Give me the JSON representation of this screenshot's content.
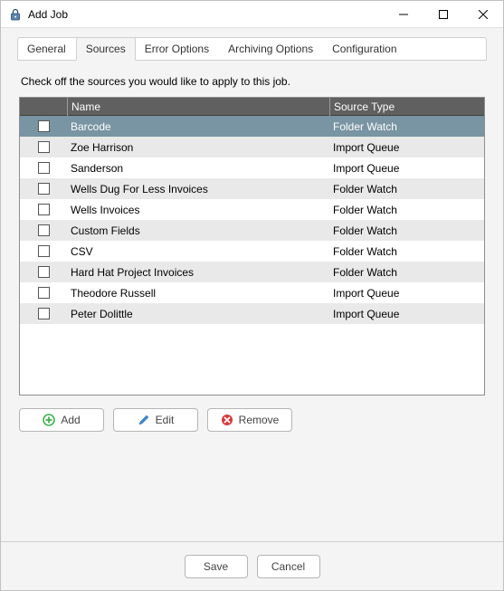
{
  "window": {
    "title": "Add Job"
  },
  "tabs": [
    {
      "label": "General"
    },
    {
      "label": "Sources"
    },
    {
      "label": "Error Options"
    },
    {
      "label": "Archiving Options"
    },
    {
      "label": "Configuration"
    }
  ],
  "instruction": "Check off the sources you would like to apply to this job.",
  "columns": {
    "name": "Name",
    "type": "Source Type"
  },
  "rows": [
    {
      "name": "Barcode",
      "type": "Folder Watch",
      "selected": true
    },
    {
      "name": "Zoe Harrison",
      "type": "Import Queue",
      "selected": false
    },
    {
      "name": "Sanderson",
      "type": "Import Queue",
      "selected": false
    },
    {
      "name": "Wells Dug For Less Invoices",
      "type": "Folder Watch",
      "selected": false
    },
    {
      "name": "Wells Invoices",
      "type": "Folder Watch",
      "selected": false
    },
    {
      "name": "Custom Fields",
      "type": "Folder Watch",
      "selected": false
    },
    {
      "name": "CSV",
      "type": "Folder Watch",
      "selected": false
    },
    {
      "name": "Hard Hat Project Invoices",
      "type": "Folder Watch",
      "selected": false
    },
    {
      "name": "Theodore Russell",
      "type": "Import Queue",
      "selected": false
    },
    {
      "name": "Peter Dolittle",
      "type": "Import Queue",
      "selected": false
    }
  ],
  "buttons": {
    "add": "Add",
    "edit": "Edit",
    "remove": "Remove",
    "save": "Save",
    "cancel": "Cancel"
  }
}
